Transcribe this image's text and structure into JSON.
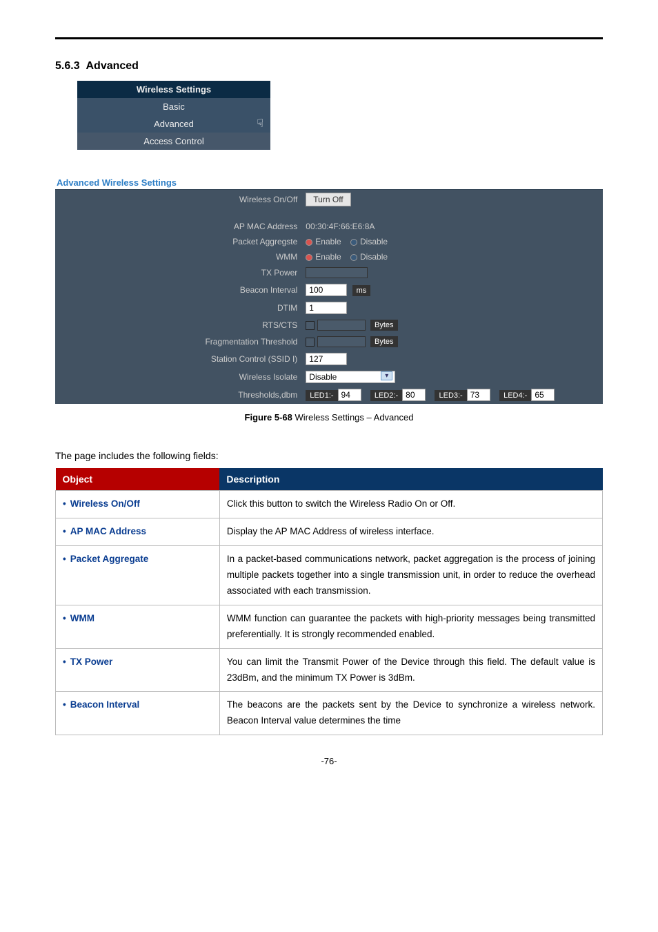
{
  "section": {
    "number": "5.6.3",
    "title": "Advanced"
  },
  "nav": {
    "header": "Wireless Settings",
    "items": [
      "Basic",
      "Advanced",
      "Access Control"
    ]
  },
  "panel": {
    "title": "Advanced Wireless Settings",
    "rows": {
      "wireless_onoff": {
        "label": "Wireless On/Off",
        "button": "Turn Off"
      },
      "ap_mac": {
        "label": "AP MAC Address",
        "value": "00:30:4F:66:E6:8A"
      },
      "packet_aggregate": {
        "label": "Packet Aggregste",
        "opt_enable": "Enable",
        "opt_disable": "Disable"
      },
      "wmm": {
        "label": "WMM",
        "opt_enable": "Enable",
        "opt_disable": "Disable"
      },
      "tx_power": {
        "label": "TX Power"
      },
      "beacon_interval": {
        "label": "Beacon Interval",
        "value": "100",
        "unit": "ms"
      },
      "dtim": {
        "label": "DTIM",
        "value": "1"
      },
      "rtscts": {
        "label": "RTS/CTS",
        "unit": "Bytes"
      },
      "frag_threshold": {
        "label": "Fragmentation Threshold",
        "unit": "Bytes"
      },
      "station_control": {
        "label": "Station Control (SSID I)",
        "value": "127"
      },
      "wireless_isolate": {
        "label": "Wireless Isolate",
        "value": "Disable"
      },
      "thresholds": {
        "label": "Thresholds,dbm",
        "led1_label": "LED1:-",
        "led1_val": "94",
        "led2_label": "LED2:-",
        "led2_val": "80",
        "led3_label": "LED3:-",
        "led3_val": "73",
        "led4_label": "LED4:-",
        "led4_val": "65"
      }
    }
  },
  "caption": {
    "figure": "Figure 5-68",
    "text": " Wireless Settings – Advanced"
  },
  "intro": "The page includes the following fields:",
  "table": {
    "headers": {
      "object": "Object",
      "description": "Description"
    },
    "rows": [
      {
        "object": "Wireless On/Off",
        "desc": "Click this button to switch the Wireless Radio On or Off."
      },
      {
        "object": "AP MAC Address",
        "desc": "Display the AP MAC Address of wireless interface."
      },
      {
        "object": "Packet Aggregate",
        "desc": "In a packet-based communications network, packet aggregation is the process of joining multiple packets together into a single transmission unit, in order to reduce the overhead associated with each transmission."
      },
      {
        "object": "WMM",
        "desc": "WMM function can guarantee the packets with high-priority messages being transmitted preferentially. It is strongly recommended enabled."
      },
      {
        "object": "TX Power",
        "desc": "You can limit the Transmit Power of the Device through this field. The default value is 23dBm, and the minimum TX Power is 3dBm."
      },
      {
        "object": "Beacon Interval",
        "desc": "The beacons are the packets sent by the Device to synchronize a wireless network. Beacon Interval value determines the time"
      }
    ]
  },
  "footer": "-76-"
}
